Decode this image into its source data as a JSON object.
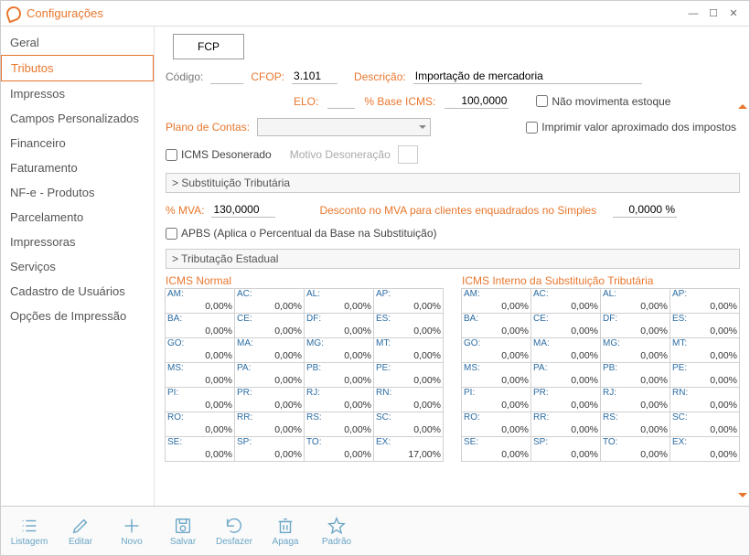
{
  "window": {
    "title": "Configurações"
  },
  "sidebar": {
    "items": [
      {
        "label": "Geral"
      },
      {
        "label": "Tributos"
      },
      {
        "label": "Impressos"
      },
      {
        "label": "Campos Personalizados"
      },
      {
        "label": "Financeiro"
      },
      {
        "label": "Faturamento"
      },
      {
        "label": "NF-e - Produtos"
      },
      {
        "label": "Parcelamento"
      },
      {
        "label": "Impressoras"
      },
      {
        "label": "Serviços"
      },
      {
        "label": "Cadastro de Usuários"
      },
      {
        "label": "Opções de Impressão"
      }
    ],
    "active_index": 1
  },
  "topbar": {
    "fcp": "FCP"
  },
  "form": {
    "codigo_label": "Código:",
    "codigo": "",
    "cfop_label": "CFOP:",
    "cfop": "3.101",
    "descricao_label": "Descrição:",
    "descricao": "Importação de mercadoria",
    "elo_label": "ELO:",
    "elo": "",
    "base_icms_label": "% Base ICMS:",
    "base_icms": "100,0000",
    "nao_movimenta": "Não movimenta estoque",
    "imprimir_aprox": "Imprimir valor aproximado dos impostos",
    "plano_label": "Plano de Contas:",
    "icms_desonerado": "ICMS Desonerado",
    "motivo_deson_label": "Motivo Desoneração"
  },
  "sections": {
    "st": "> Substituição Tributária",
    "te": "> Tributação Estadual"
  },
  "st": {
    "mva_label": "% MVA:",
    "mva": "130,0000",
    "desc_label": "Desconto no MVA para clientes enquadrados no Simples",
    "desc": "0,0000 %",
    "apbs": "APBS (Aplica o Percentual da Base na Substituição)"
  },
  "grids": {
    "left_title": "ICMS Normal",
    "right_title": "ICMS Interno da Substituição Tributária",
    "left": [
      {
        "st": "AM:",
        "v": "0,00%"
      },
      {
        "st": "AC:",
        "v": "0,00%"
      },
      {
        "st": "AL:",
        "v": "0,00%"
      },
      {
        "st": "AP:",
        "v": "0,00%"
      },
      {
        "st": "BA:",
        "v": "0,00%"
      },
      {
        "st": "CE:",
        "v": "0,00%"
      },
      {
        "st": "DF:",
        "v": "0,00%"
      },
      {
        "st": "ES:",
        "v": "0,00%"
      },
      {
        "st": "GO:",
        "v": "0,00%"
      },
      {
        "st": "MA:",
        "v": "0,00%"
      },
      {
        "st": "MG:",
        "v": "0,00%"
      },
      {
        "st": "MT:",
        "v": "0,00%"
      },
      {
        "st": "MS:",
        "v": "0,00%"
      },
      {
        "st": "PA:",
        "v": "0,00%"
      },
      {
        "st": "PB:",
        "v": "0,00%"
      },
      {
        "st": "PE:",
        "v": "0,00%"
      },
      {
        "st": "PI:",
        "v": "0,00%"
      },
      {
        "st": "PR:",
        "v": "0,00%"
      },
      {
        "st": "RJ:",
        "v": "0,00%"
      },
      {
        "st": "RN:",
        "v": "0,00%"
      },
      {
        "st": "RO:",
        "v": "0,00%"
      },
      {
        "st": "RR:",
        "v": "0,00%"
      },
      {
        "st": "RS:",
        "v": "0,00%"
      },
      {
        "st": "SC:",
        "v": "0,00%"
      },
      {
        "st": "SE:",
        "v": "0,00%"
      },
      {
        "st": "SP:",
        "v": "0,00%"
      },
      {
        "st": "TO:",
        "v": "0,00%"
      },
      {
        "st": "EX:",
        "v": "17,00%"
      }
    ],
    "right": [
      {
        "st": "AM:",
        "v": "0,00%"
      },
      {
        "st": "AC:",
        "v": "0,00%"
      },
      {
        "st": "AL:",
        "v": "0,00%"
      },
      {
        "st": "AP:",
        "v": "0,00%"
      },
      {
        "st": "BA:",
        "v": "0,00%"
      },
      {
        "st": "CE:",
        "v": "0,00%"
      },
      {
        "st": "DF:",
        "v": "0,00%"
      },
      {
        "st": "ES:",
        "v": "0,00%"
      },
      {
        "st": "GO:",
        "v": "0,00%"
      },
      {
        "st": "MA:",
        "v": "0,00%"
      },
      {
        "st": "MG:",
        "v": "0,00%"
      },
      {
        "st": "MT:",
        "v": "0,00%"
      },
      {
        "st": "MS:",
        "v": "0,00%"
      },
      {
        "st": "PA:",
        "v": "0,00%"
      },
      {
        "st": "PB:",
        "v": "0,00%"
      },
      {
        "st": "PE:",
        "v": "0,00%"
      },
      {
        "st": "PI:",
        "v": "0,00%"
      },
      {
        "st": "PR:",
        "v": "0,00%"
      },
      {
        "st": "RJ:",
        "v": "0,00%"
      },
      {
        "st": "RN:",
        "v": "0,00%"
      },
      {
        "st": "RO:",
        "v": "0,00%"
      },
      {
        "st": "RR:",
        "v": "0,00%"
      },
      {
        "st": "RS:",
        "v": "0,00%"
      },
      {
        "st": "SC:",
        "v": "0,00%"
      },
      {
        "st": "SE:",
        "v": "0,00%"
      },
      {
        "st": "SP:",
        "v": "0,00%"
      },
      {
        "st": "TO:",
        "v": "0,00%"
      },
      {
        "st": "EX:",
        "v": "0,00%"
      }
    ]
  },
  "footer": {
    "items": [
      {
        "name": "listagem",
        "label": "Listagem"
      },
      {
        "name": "editar",
        "label": "Editar"
      },
      {
        "name": "novo",
        "label": "Novo"
      },
      {
        "name": "salvar",
        "label": "Salvar"
      },
      {
        "name": "desfazer",
        "label": "Desfazer"
      },
      {
        "name": "apaga",
        "label": "Apaga"
      },
      {
        "name": "padrao",
        "label": "Padrão"
      }
    ]
  }
}
